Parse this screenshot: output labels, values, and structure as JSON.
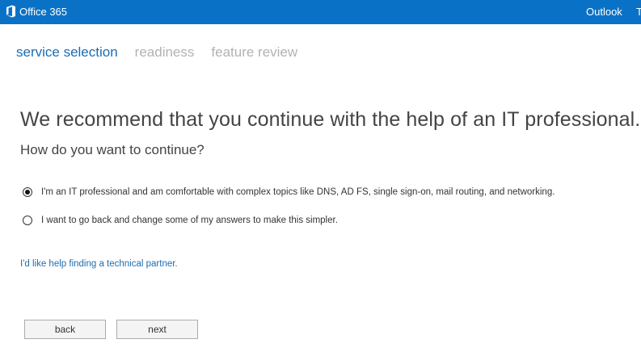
{
  "header": {
    "brand": "Office 365",
    "logo_icon": "office-logo-icon",
    "nav_items": [
      "Outlook",
      "T"
    ],
    "bar_color": "#0a72c6"
  },
  "steps": [
    {
      "label": "service selection",
      "active": true
    },
    {
      "label": "readiness",
      "active": false
    },
    {
      "label": "feature review",
      "active": false
    }
  ],
  "main": {
    "headline": "We recommend that you continue with the help of an IT professional.",
    "subhead": "How do you want to continue?",
    "options": [
      {
        "label": "I'm an IT professional and am comfortable with complex topics like DNS, AD FS, single sign-on, mail routing, and networking.",
        "checked": true
      },
      {
        "label": "I want to go back and change some of my answers to make this simpler.",
        "checked": false
      }
    ],
    "help_link": "I'd like help finding a technical partner."
  },
  "buttons": {
    "back": "back",
    "next": "next"
  },
  "colors": {
    "accent": "#1a6db3",
    "inactive_step": "#b2b2b2"
  }
}
